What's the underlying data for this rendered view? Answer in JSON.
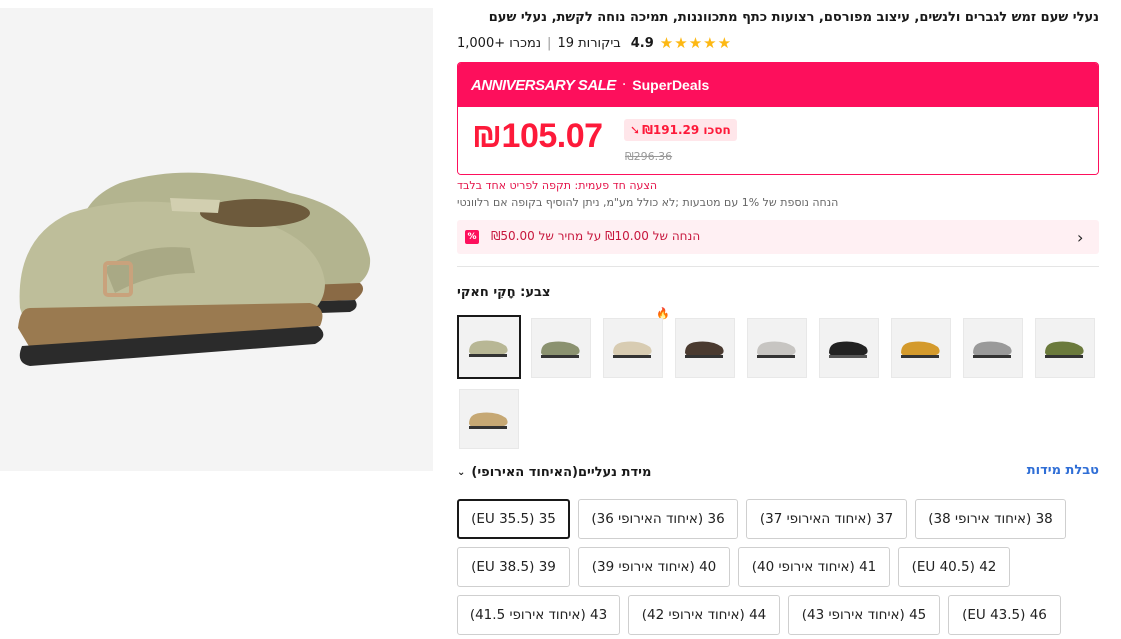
{
  "product": {
    "title": "נעלי שעם זמש לגברים ולנשים, עיצוב מפורסם, רצועות כתף מתכווננות, תמיכה נוחה לקשת, נעלי שעם",
    "rating": "4.9",
    "reviews": "19 ביקורות",
    "sold": "1,000+ נמכרו"
  },
  "sale": {
    "brand": "ANNIVERSARY SALE",
    "dot": "·",
    "sub": "SuperDeals",
    "price": "₪105.07",
    "save": "חסכו ₪191.29",
    "old_price": "₪296.36",
    "accent": "#fd0f5c"
  },
  "notes": {
    "offer": "הצעה חד פעמית: תקפה לפריט אחד בלבד",
    "extra": "הנחה נוספת של 1% עם מטבעות ;לא כולל מע\"מ, ניתן להוסיף בקופה אם רלוונטי"
  },
  "coupon": {
    "text": "הנחה של ₪10.00 על מחיר של ₪50.00",
    "badge": "%"
  },
  "color": {
    "label": "צבע: חָקִי חאקי",
    "swatches": [
      {
        "name": "khaki",
        "color": "#b8b795",
        "selected": true
      },
      {
        "name": "green",
        "color": "#8b9270"
      },
      {
        "name": "beige",
        "color": "#d8ccb2"
      },
      {
        "name": "dark-brown",
        "color": "#4a3a30"
      },
      {
        "name": "light-gray",
        "color": "#c7c5c2"
      },
      {
        "name": "black",
        "color": "#222222"
      },
      {
        "name": "yellow",
        "color": "#d49a2c"
      },
      {
        "name": "gray",
        "color": "#9a9a9a"
      },
      {
        "name": "olive",
        "color": "#6b7a3c"
      },
      {
        "name": "sand",
        "color": "#c6a874"
      }
    ]
  },
  "size": {
    "label": "מידת נעליים(האיחוד האירופי)",
    "chart_link": "טבלת מידות",
    "options": [
      "35 (EU 35.5)",
      "36 (איחוד האירופי 36)",
      "37 (איחוד האירופי 37)",
      "38 (איחוד אירופי 38)",
      "39 (EU 38.5)",
      "40 (איחוד אירופי 39)",
      "41 (איחוד אירופי 40)",
      "42 (EU 40.5)",
      "43 (איחוד אירופי 41.5)",
      "44 (איחוד אירופי 42)",
      "45 (איחוד אירופי 43)",
      "46 (EU 43.5)"
    ],
    "selected": "35 (EU 35.5)"
  }
}
